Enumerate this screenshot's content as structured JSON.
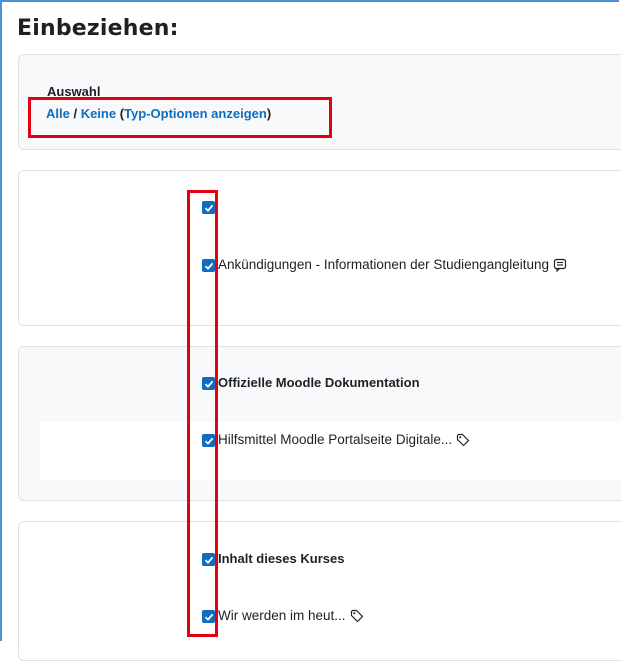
{
  "page": {
    "title": "Einbeziehen:"
  },
  "selection": {
    "heading": "Auswahl",
    "all_label": "Alle",
    "separator": " / ",
    "none_label": "Keine",
    "paren_open": " (",
    "type_options_label": "Typ-Optionen anzeigen",
    "paren_close": ")"
  },
  "sections": [
    {
      "section_checked": true,
      "section_label": "",
      "items": [
        {
          "label": "Ankündigungen - Informationen der Studiengangleitung",
          "checked": true,
          "icon": "forum-icon"
        }
      ]
    },
    {
      "section_checked": true,
      "section_label": "Offizielle Moodle Dokumentation",
      "items": [
        {
          "label": "Hilfsmittel Moodle Portalseite Digitale...",
          "checked": true,
          "icon": "label-icon"
        }
      ]
    },
    {
      "section_checked": true,
      "section_label": "Inhalt dieses Kurses",
      "items": [
        {
          "label": "Wir werden im heut...",
          "checked": true,
          "icon": "label-icon"
        }
      ]
    }
  ],
  "colors": {
    "accent": "#0f6cbf",
    "highlight": "#e3000f",
    "frame": "#4c8fd6"
  }
}
